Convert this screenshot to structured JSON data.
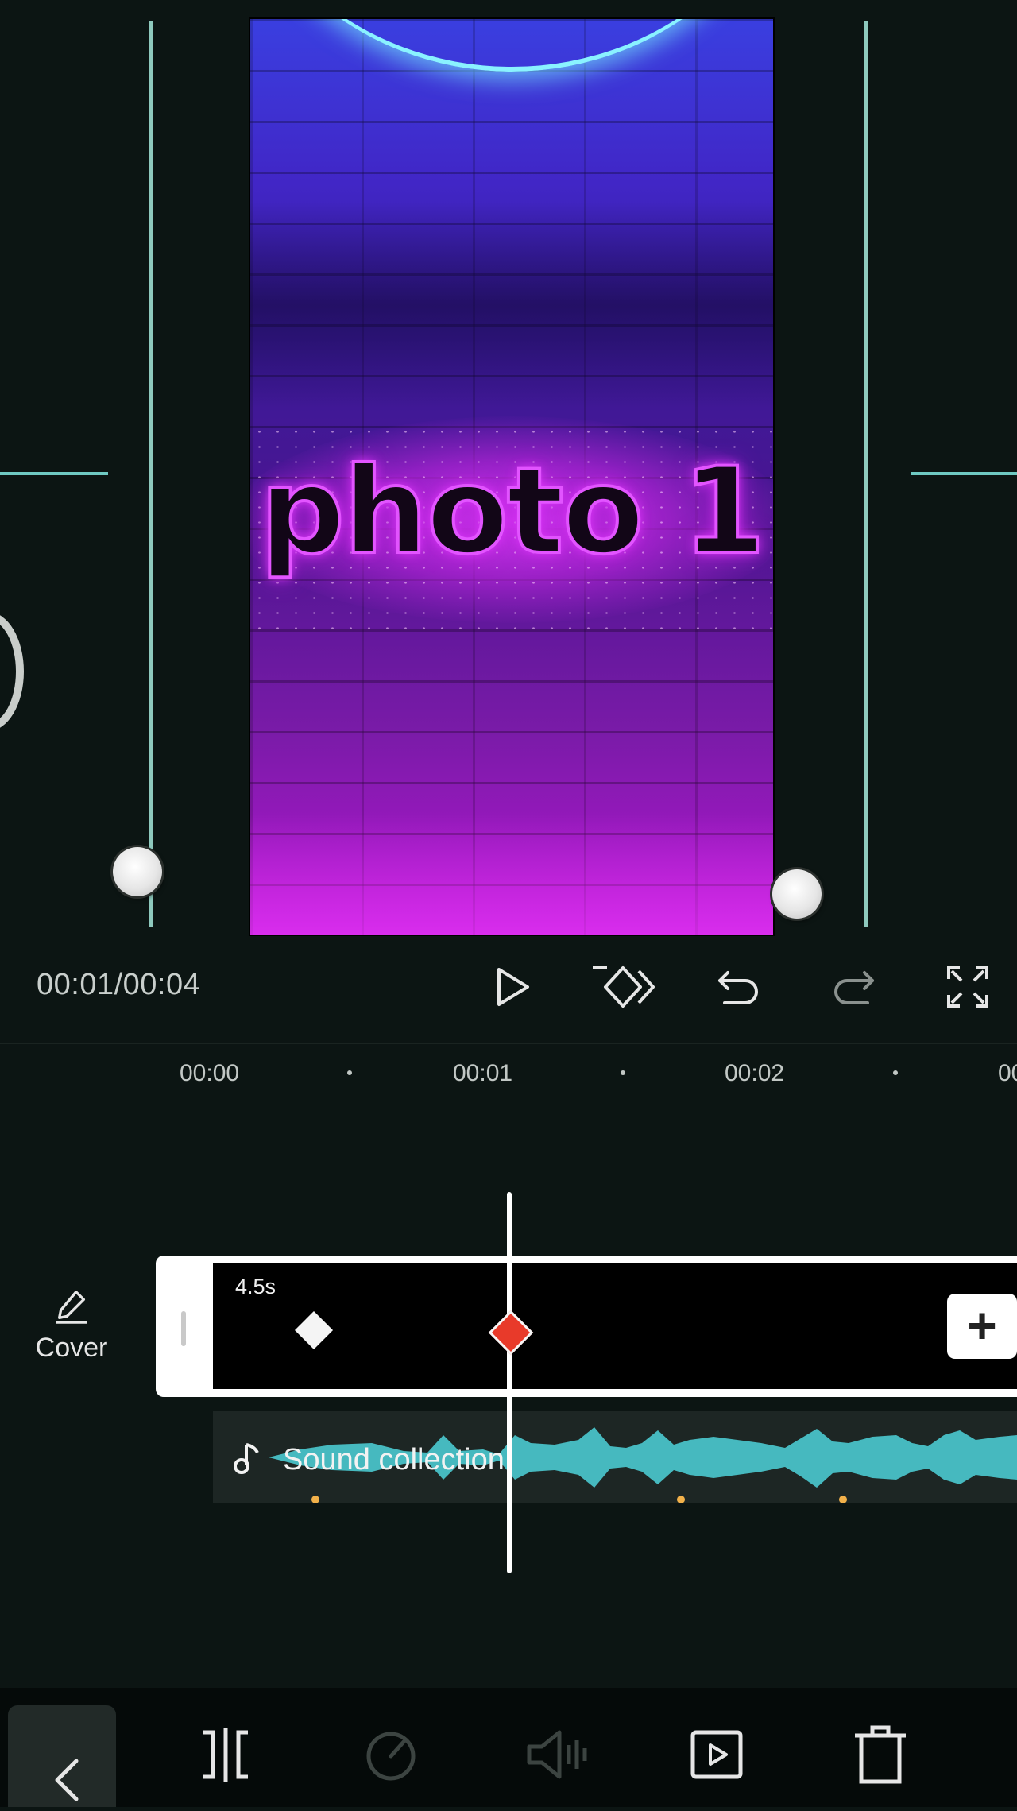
{
  "preview": {
    "overlay_text": "photo 1"
  },
  "controls": {
    "timecode": "00:01/00:04",
    "icons": [
      "play-icon",
      "keyframe-icon",
      "undo-icon",
      "redo-icon",
      "fullscreen-icon"
    ]
  },
  "ruler": {
    "labels": [
      "00:00",
      "00:01",
      "00:02",
      "00"
    ]
  },
  "timeline": {
    "cover_label": "Cover",
    "clip_duration": "4.5s",
    "audio_label": "Sound collection",
    "add_label": "+"
  },
  "toolbar": {
    "icons": [
      "back-icon",
      "split-icon",
      "speed-icon",
      "volume-icon",
      "animation-icon",
      "delete-icon"
    ]
  },
  "colors": {
    "background": "#0c1513",
    "guide": "#8ec9bd",
    "keyframe_active": "#e83a2a",
    "waveform": "#46b9bf",
    "beat_marker": "#f2b14a"
  }
}
